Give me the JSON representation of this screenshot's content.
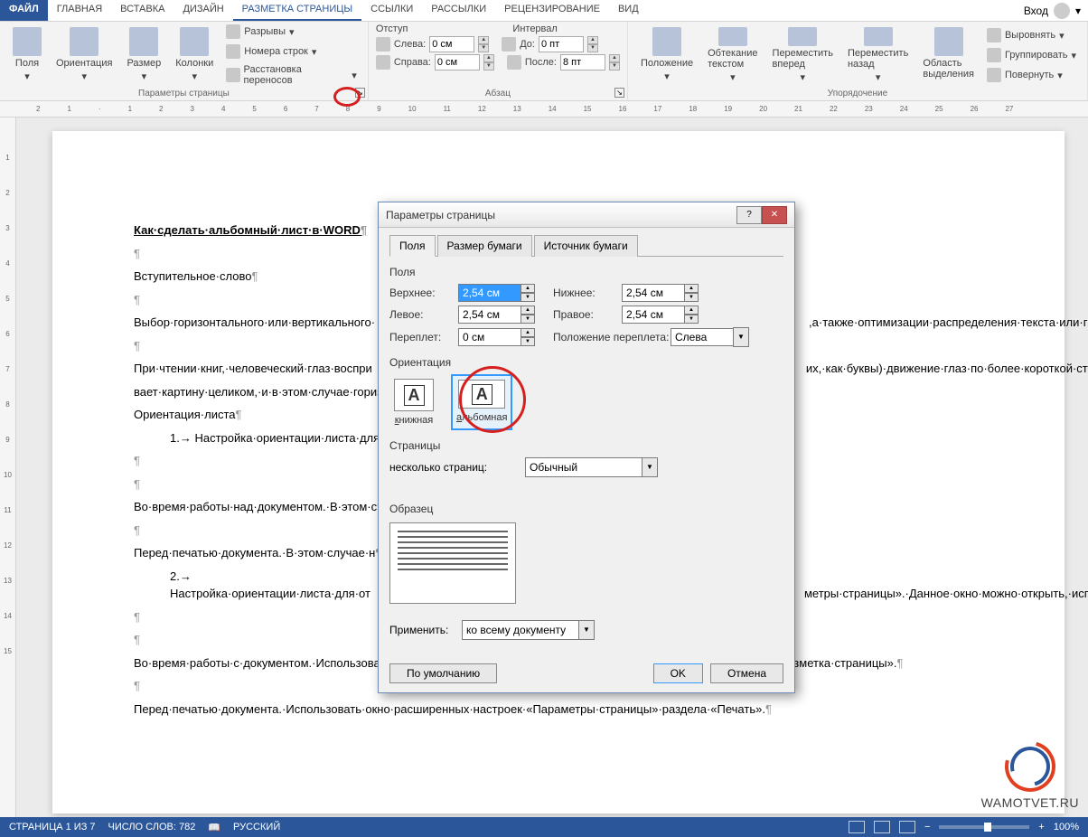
{
  "menu": {
    "file": "ФАЙЛ",
    "tabs": [
      "ГЛАВНАЯ",
      "ВСТАВКА",
      "ДИЗАЙН",
      "РАЗМЕТКА СТРАНИЦЫ",
      "ССЫЛКИ",
      "РАССЫЛКИ",
      "РЕЦЕНЗИРОВАНИЕ",
      "ВИД"
    ],
    "active_index": 3,
    "login": "Вход"
  },
  "ribbon": {
    "page_setup": {
      "label": "Параметры страницы",
      "fields": "Поля",
      "orientation": "Ориентация",
      "size": "Размер",
      "columns": "Колонки",
      "breaks": "Разрывы",
      "line_numbers": "Номера строк",
      "hyphenation": "Расстановка переносов"
    },
    "paragraph": {
      "label": "Абзац",
      "indent_title": "Отступ",
      "spacing_title": "Интервал",
      "left": "Слева:",
      "right": "Справа:",
      "before": "До:",
      "after": "После:",
      "left_val": "0 см",
      "right_val": "0 см",
      "before_val": "0 пт",
      "after_val": "8 пт"
    },
    "arrange": {
      "label": "Упорядочение",
      "position": "Положение",
      "wrap": "Обтекание текстом",
      "forward": "Переместить вперед",
      "backward": "Переместить назад",
      "selection": "Область выделения",
      "align": "Выровнять",
      "group": "Группировать",
      "rotate": "Повернуть"
    }
  },
  "doc": {
    "title": "Как·сделать·альбомный·лист·в·WORD",
    "p1": "Вступительное·слово",
    "p2": "Выбор·горизонтального·или·вертикального·",
    "p2b": ",а·также·оптимизации·распределения·текста·или·графических·об",
    "p3": "При·чтении·книг,·человеческий·глаз·воспри",
    "p3b": "их,·как·буквы)·движение·глаз·по·более·короткой·строке·требует·меньшей·",
    "p3c": "вает·картину·целиком,·и·в·этом·случае·горизонтальный·формат·пред",
    "p4": "Ориентация·листа",
    "p5": "1.→ Настройка·ориентации·листа·для·до",
    "p6": "Во·время·работы·над·документом.·В·этом·с",
    "p7": "Перед·печатью·документа.·В·этом·случае·н",
    "p8": "2.→ Настройка·ориентации·листа·для·от",
    "p8b": "метры·страницы».·Данное·окно·можно·открыть,·используя·раз",
    "p9": "Во·время·работы·с·документом.·Использовать·окно·расширенных·настроек·«Параметры·страницы»·вкладки·меню·«Разметка·страницы».",
    "p10": "Перед·печатью·документа.·Использовать·окно·расширенных·настроек·«Параметры·страницы»·раздела·«Печать»."
  },
  "dialog": {
    "title": "Параметры страницы",
    "tabs": [
      "Поля",
      "Размер бумаги",
      "Источник бумаги"
    ],
    "fields_section": "Поля",
    "top": "Верхнее:",
    "bottom": "Нижнее:",
    "left": "Левое:",
    "right": "Правое:",
    "gutter": "Переплет:",
    "gutter_pos": "Положение переплета:",
    "top_val": "2,54 см",
    "bottom_val": "2,54 см",
    "left_val": "2,54 см",
    "right_val": "2,54 см",
    "gutter_val": "0 см",
    "gutter_pos_val": "Слева",
    "orientation_section": "Ориентация",
    "portrait": "книжная",
    "landscape": "альбомная",
    "pages_section": "Страницы",
    "multi_pages": "несколько страниц:",
    "multi_val": "Обычный",
    "sample_section": "Образец",
    "apply": "Применить:",
    "apply_val": "ко всему документу",
    "default_btn": "По умолчанию",
    "ok": "OK",
    "cancel": "Отмена"
  },
  "status": {
    "page": "СТРАНИЦА 1 ИЗ 7",
    "words": "ЧИСЛО СЛОВ: 782",
    "lang": "РУССКИЙ",
    "zoom": "100%"
  },
  "watermark": "WAMOTVET.RU"
}
